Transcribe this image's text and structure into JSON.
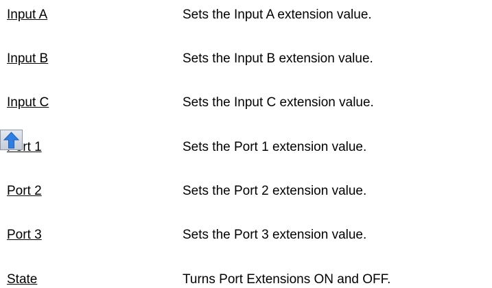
{
  "rows": [
    {
      "term": "Input A",
      "description": "Sets the Input A extension value."
    },
    {
      "term": "Input B",
      "description": "Sets the Input B extension value."
    },
    {
      "term": "Input C",
      "description": "Sets the Input C extension value."
    },
    {
      "term": "Port 1",
      "description": "Sets the Port 1 extension value."
    },
    {
      "term": "Port 2",
      "description": "Sets the Port 2 extension value."
    },
    {
      "term": "Port 3",
      "description": "Sets the Port 3 extension value."
    },
    {
      "term": "State",
      "description": "Turns Port Extensions ON and OFF."
    }
  ],
  "nav": {
    "up_icon": "arrow-up-icon",
    "up_icon_color": "#2f7fe3"
  }
}
